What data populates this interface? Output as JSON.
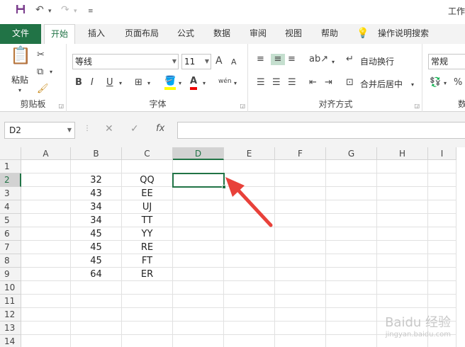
{
  "window": {
    "title_partial": "工作"
  },
  "quick_access": {
    "icons": [
      "save-icon",
      "undo-icon",
      "redo-icon",
      "customize-icon"
    ]
  },
  "tabs": [
    {
      "label": "文件"
    },
    {
      "label": "开始"
    },
    {
      "label": "插入"
    },
    {
      "label": "页面布局"
    },
    {
      "label": "公式"
    },
    {
      "label": "数据"
    },
    {
      "label": "审阅"
    },
    {
      "label": "视图"
    },
    {
      "label": "帮助"
    },
    {
      "label": "操作说明搜索"
    }
  ],
  "ribbon": {
    "clipboard": {
      "label": "剪贴板",
      "paste_label": "粘贴"
    },
    "font": {
      "label": "字体",
      "font_name": "等线",
      "font_size": "11",
      "bold": "B",
      "italic": "I",
      "underline": "U",
      "grow": "A",
      "shrink": "A",
      "font_color": "A",
      "phonetic": "wén"
    },
    "alignment": {
      "label": "对齐方式",
      "wrap_text": "自动换行",
      "merge_center": "合并后居中"
    },
    "number": {
      "format": "常规",
      "label_partial": "数"
    }
  },
  "formula_bar": {
    "name_box": "D2",
    "cancel": "✕",
    "enter": "✓",
    "fx": "fx",
    "value": ""
  },
  "grid": {
    "columns": [
      "A",
      "B",
      "C",
      "D",
      "E",
      "F",
      "G",
      "H",
      "I"
    ],
    "rows": [
      "1",
      "2",
      "3",
      "4",
      "5",
      "6",
      "7",
      "8",
      "9",
      "10",
      "11",
      "12",
      "13",
      "14"
    ],
    "selected_cell": "D2",
    "data": [
      {
        "B": "",
        "C": ""
      },
      {
        "B": "32",
        "C": "QQ"
      },
      {
        "B": "43",
        "C": "EE"
      },
      {
        "B": "34",
        "C": "UJ"
      },
      {
        "B": "34",
        "C": "TT"
      },
      {
        "B": "45",
        "C": "YY"
      },
      {
        "B": "45",
        "C": "RE"
      },
      {
        "B": "45",
        "C": "FT"
      },
      {
        "B": "64",
        "C": "ER"
      }
    ]
  },
  "watermark": {
    "text": "Baidu 经验",
    "sub": "jingyan.baidu.com"
  },
  "colors": {
    "accent": "#217346",
    "arrow": "#e8413a"
  }
}
